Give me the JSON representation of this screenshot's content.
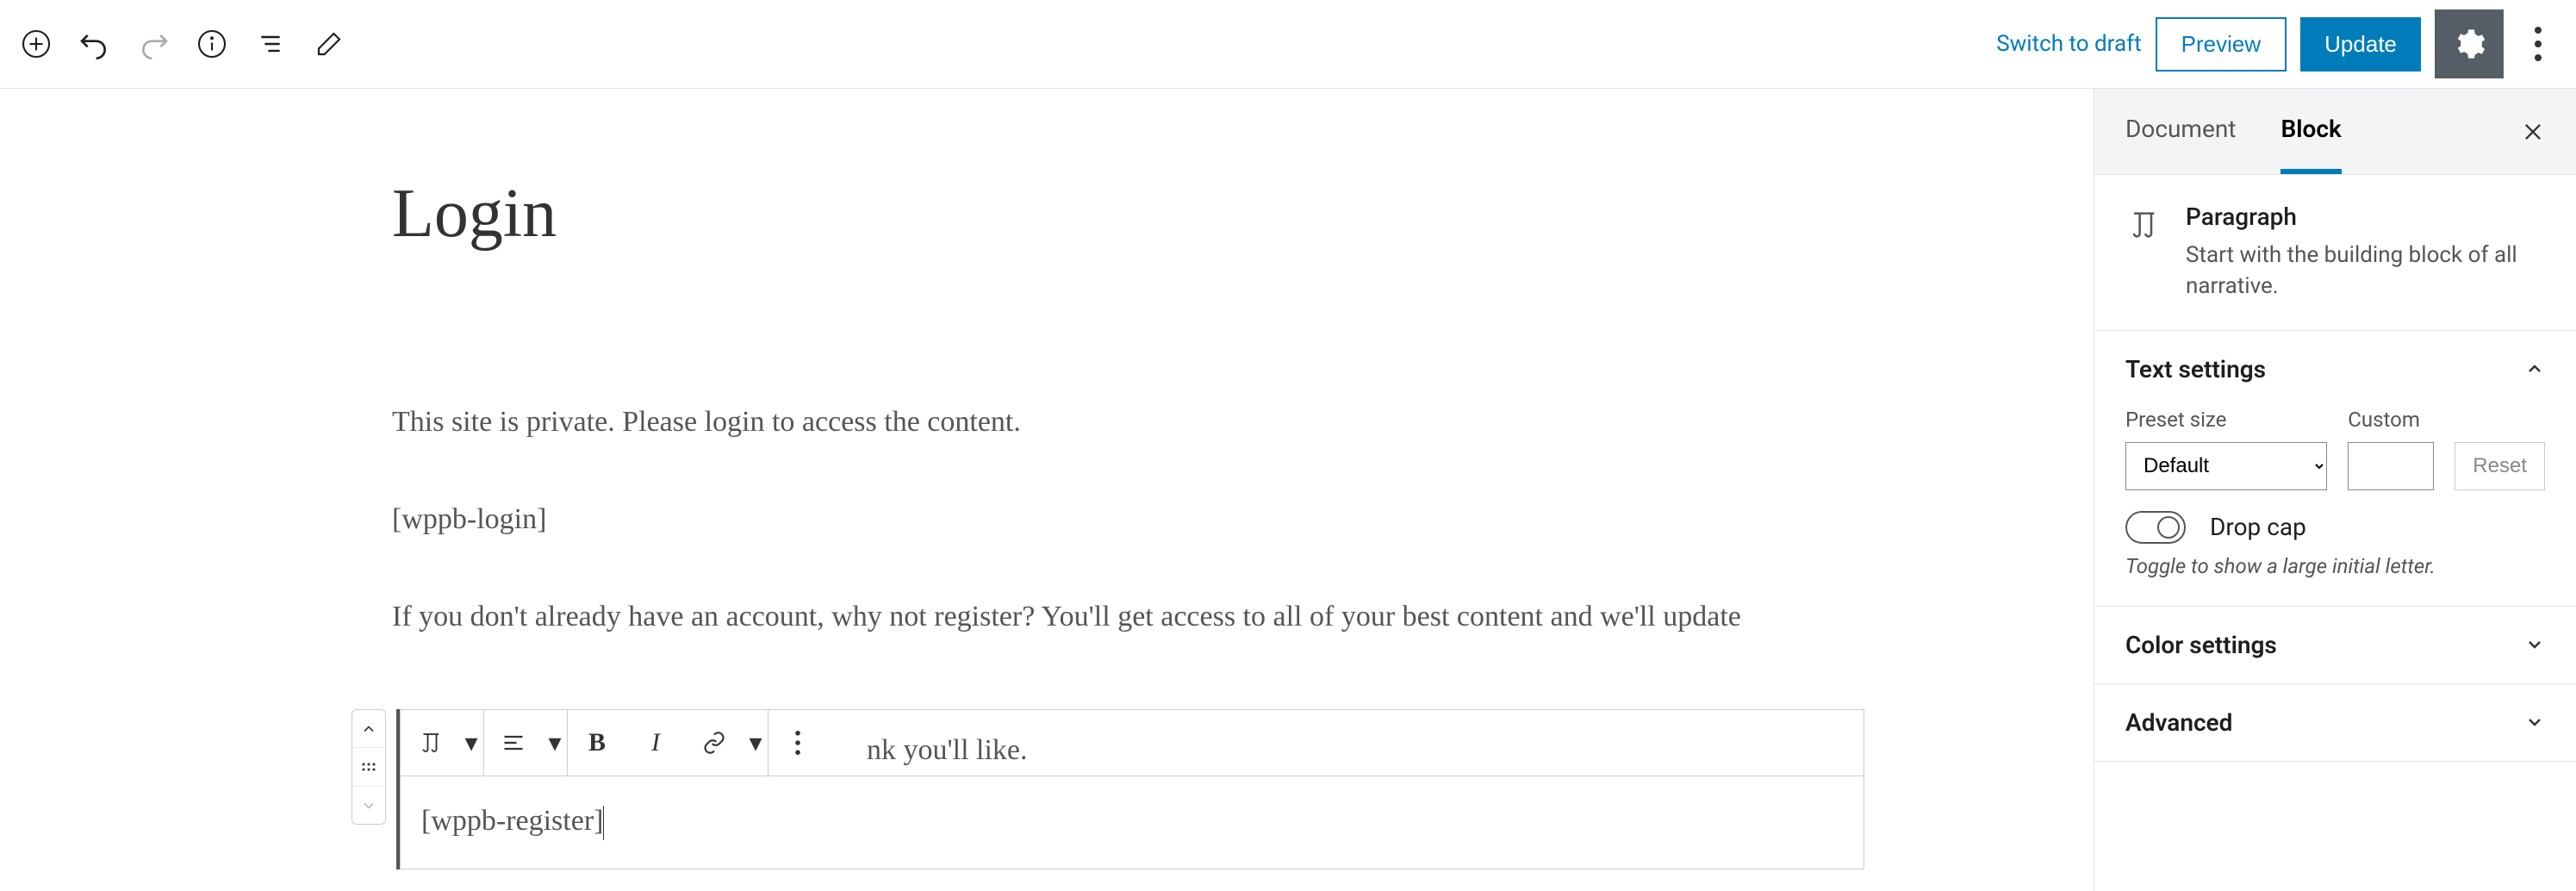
{
  "header": {
    "switch_to_draft": "Switch to draft",
    "preview": "Preview",
    "update": "Update"
  },
  "page": {
    "title": "Login",
    "para1": "This site is private. Please login to access the content.",
    "para2": "[wppb-login]",
    "para3": "If you don't already have an account, why not register? You'll get access to all of your best content and we'll update",
    "para3b": "nk you'll like.",
    "active_block_text": "[wppb-register]"
  },
  "sidebar": {
    "tabs": {
      "document": "Document",
      "block": "Block"
    },
    "block_info": {
      "name": "Paragraph",
      "desc": "Start with the building block of all narrative."
    },
    "text_settings": {
      "title": "Text settings",
      "preset_label": "Preset size",
      "preset_value": "Default",
      "custom_label": "Custom",
      "reset": "Reset",
      "dropcap_label": "Drop cap",
      "dropcap_hint": "Toggle to show a large initial letter."
    },
    "color_settings": {
      "title": "Color settings"
    },
    "advanced": {
      "title": "Advanced"
    }
  }
}
